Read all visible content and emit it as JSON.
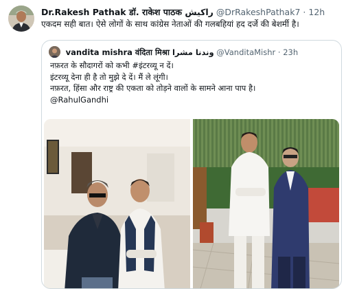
{
  "tweet": {
    "author_name": "Dr.Rakesh Pathak डॉ. राकेश पाठक راکیش",
    "handle": "@DrRakeshPathak7",
    "separator": "·",
    "time": "12h",
    "text": "एकदम सही बात। ऐसे लोगों के साथ कांग्रेस नेताओं की गलबहियां हद दर्जे की बेशर्मी है।"
  },
  "quoted_tweet": {
    "author_name": "vandita mishra वंदिता मिश्रा وندنا مشرا",
    "handle": "@VanditaMishr",
    "separator": "·",
    "time": "23h",
    "lines": [
      "नफ़रत के सौदागरों को कभी #इंटरव्यू न दें।",
      "इंटरव्यू देना ही है तो मुझे दे दें। मैं ले लूंगी।",
      "नफ़रत, हिंसा और राष्ट्र की एकता को तोड़ने वालों के सामने आना पाप है।"
    ],
    "mention": "@RahulGandhi"
  },
  "icons": {
    "main_avatar": "profile-photo",
    "quote_avatar": "profile-photo"
  },
  "colors": {
    "text_primary": "#0f1419",
    "text_secondary": "#536471",
    "border": "#cfd9de"
  }
}
